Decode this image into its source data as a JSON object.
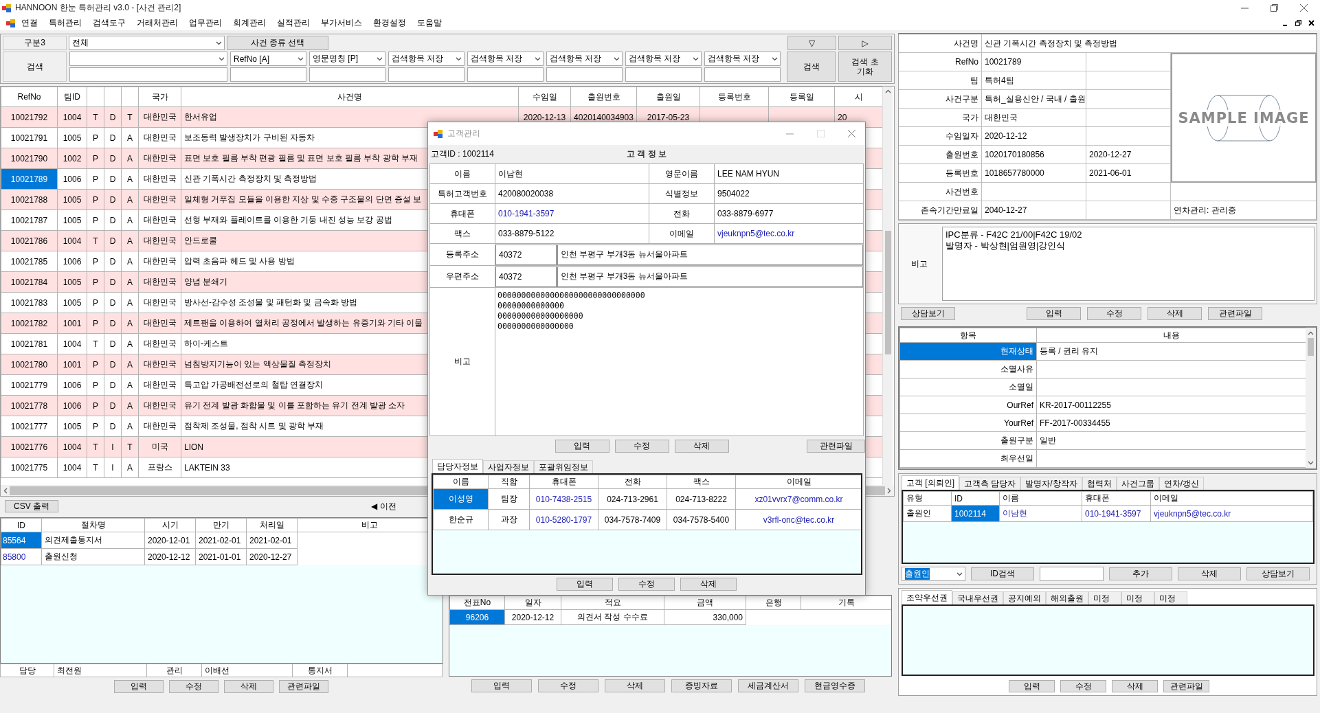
{
  "window": {
    "title": "HANNOON 한눈 특허관리 v3.0 - [사건 관리2]"
  },
  "menu": [
    "연결",
    "특허관리",
    "검색도구",
    "거래처관리",
    "업무관리",
    "회계관리",
    "실적관리",
    "부가서비스",
    "환경설정",
    "도움말"
  ],
  "filter": {
    "category_label": "구분3",
    "category_value": "전체",
    "case_type_button": "사건 종류 선택",
    "collapse_button": "▽",
    "next_button": "▷",
    "search_label": "검색",
    "search_fields": [
      {
        "kind": "wide"
      },
      {
        "kind": "normal",
        "selector": "RefNo [A]"
      },
      {
        "kind": "normal",
        "selector": "영문명칭 [P]"
      },
      {
        "kind": "normal",
        "selector": "검색항목 저장"
      },
      {
        "kind": "normal",
        "selector": "검색항목 저장"
      },
      {
        "kind": "normal",
        "selector": "검색항목 저장"
      },
      {
        "kind": "normal",
        "selector": "검색항목 저장"
      },
      {
        "kind": "normal",
        "selector": "검색항목 저장"
      }
    ],
    "search_button": "검색",
    "reset_button": "검색 초기화"
  },
  "case_table": {
    "headers": {
      "refno": "RefNo",
      "team_id": "팀ID",
      "country": "국가",
      "title": "사건명",
      "received": "수임일",
      "app_no": "출원번호",
      "app_date": "출원일",
      "reg_no": "등록번호",
      "reg_date": "등록일",
      "column_13": "시"
    },
    "rows": [
      {
        "refno": "10021792",
        "team_id": "1004",
        "column_3": "T",
        "column_4": "D",
        "column_5": "T",
        "country": "대한민국",
        "title": "한서유업",
        "received": "2020-12-13",
        "app_no": "4020140034903",
        "app_date": "2017-05-23",
        "column_13": "20",
        "selected": false
      },
      {
        "refno": "10021791",
        "team_id": "1005",
        "column_3": "P",
        "column_4": "D",
        "column_5": "A",
        "country": "대한민국",
        "title": "보조동력 발생장치가 구비된 자동차",
        "selected": false
      },
      {
        "refno": "10021790",
        "team_id": "1002",
        "column_3": "P",
        "column_4": "D",
        "column_5": "A",
        "country": "대한민국",
        "title": "표면 보호 필름 부착 편광 필름 및 표면 보호 필름 부착 광학 부재",
        "selected": false
      },
      {
        "refno": "10021789",
        "team_id": "1006",
        "column_3": "P",
        "column_4": "D",
        "column_5": "A",
        "country": "대한민국",
        "title": "신관 기폭시간 측정장치 및 측정방법",
        "selected": true
      },
      {
        "refno": "10021788",
        "team_id": "1005",
        "column_3": "P",
        "column_4": "D",
        "column_5": "A",
        "country": "대한민국",
        "title": "일체형 거푸집 모듈을 이용한 지상 및 수중 구조물의 단면 증설 보",
        "selected": false
      },
      {
        "refno": "10021787",
        "team_id": "1005",
        "column_3": "P",
        "column_4": "D",
        "column_5": "A",
        "country": "대한민국",
        "title": "선형 부재와 플레이트를 이용한 기둥 내진 성능 보강 공법",
        "selected": false
      },
      {
        "refno": "10021786",
        "team_id": "1004",
        "column_3": "T",
        "column_4": "D",
        "column_5": "A",
        "country": "대한민국",
        "title": "안드로쿨",
        "selected": false
      },
      {
        "refno": "10021785",
        "team_id": "1006",
        "column_3": "P",
        "column_4": "D",
        "column_5": "A",
        "country": "대한민국",
        "title": "압력 초음파 헤드 및 사용 방법",
        "selected": false
      },
      {
        "refno": "10021784",
        "team_id": "1005",
        "column_3": "P",
        "column_4": "D",
        "column_5": "A",
        "country": "대한민국",
        "title": "양념 분쇄기",
        "selected": false
      },
      {
        "refno": "10021783",
        "team_id": "1005",
        "column_3": "P",
        "column_4": "D",
        "column_5": "A",
        "country": "대한민국",
        "title": "방사선-감수성 조성물 및 패턴화 및 금속화 방법",
        "selected": false
      },
      {
        "refno": "10021782",
        "team_id": "1001",
        "column_3": "P",
        "column_4": "D",
        "column_5": "A",
        "country": "대한민국",
        "title": "제트팬을 이용하여 열처리 공정에서 발생하는 유증기와 기타 이물",
        "selected": false
      },
      {
        "refno": "10021781",
        "team_id": "1004",
        "column_3": "T",
        "column_4": "D",
        "column_5": "A",
        "country": "대한민국",
        "title": "하이-케스트",
        "selected": false
      },
      {
        "refno": "10021780",
        "team_id": "1001",
        "column_3": "P",
        "column_4": "D",
        "column_5": "A",
        "country": "대한민국",
        "title": "넘침방지기능이 있는 액상물질 측정장치",
        "selected": false
      },
      {
        "refno": "10021779",
        "team_id": "1006",
        "column_3": "P",
        "column_4": "D",
        "column_5": "A",
        "country": "대한민국",
        "title": "특고압 가공배전선로의 철탑 연결장치",
        "selected": false
      },
      {
        "refno": "10021778",
        "team_id": "1006",
        "column_3": "P",
        "column_4": "D",
        "column_5": "A",
        "country": "대한민국",
        "title": "유기 전계 발광 화합물 및 이를 포함하는 유기 전계 발광 소자",
        "selected": false
      },
      {
        "refno": "10021777",
        "team_id": "1005",
        "column_3": "P",
        "column_4": "D",
        "column_5": "A",
        "country": "대한민국",
        "title": "점착제 조성물, 점착 시트 및 광학 부재",
        "selected": false
      },
      {
        "refno": "10021776",
        "team_id": "1004",
        "column_3": "T",
        "column_4": "I",
        "column_5": "T",
        "country": "미국",
        "title": "LION",
        "selected": false
      },
      {
        "refno": "10021775",
        "team_id": "1004",
        "column_3": "T",
        "column_4": "I",
        "column_5": "A",
        "country": "프랑스",
        "title": "LAKTEIN 33",
        "selected": false
      }
    ]
  },
  "csv_button": "CSV 출력",
  "previous_button": "◀ 이전",
  "procedures": {
    "headers": [
      "ID",
      "절차명",
      "시기",
      "만기",
      "처리일",
      "비고"
    ],
    "rows": [
      {
        "cells": [
          "85564",
          "의견제출통지서",
          "2020-12-01",
          "2021-02-01",
          "2021-02-01"
        ],
        "selected": true
      },
      {
        "cells": [
          "85800",
          "출원신청",
          "2020-12-12",
          "2021-01-01",
          "2020-12-27"
        ],
        "selected": false
      }
    ],
    "footer": [
      {
        "label": "담당",
        "value": "최전원"
      },
      {
        "label": "관리",
        "value": "이배선"
      },
      {
        "label": "통지서"
      }
    ],
    "buttons": [
      "입력",
      "수정",
      "삭제",
      "관련파일"
    ]
  },
  "accounting": {
    "headers": [
      "전표No",
      "일자",
      "적요",
      "금액",
      "은행",
      "기록"
    ],
    "rows": [
      {
        "cells": [
          "96206",
          "2020-12-12",
          "의견서 작성 수수료",
          "330,000"
        ],
        "selected": true
      }
    ],
    "buttons": [
      "입력",
      "수정",
      "삭제",
      "증빙자료",
      "세금계산서",
      "현금영수증"
    ]
  },
  "case_info": {
    "rows": [
      {
        "kind": "wide",
        "label": "사건명",
        "value": "신관 기폭시간 측정장치 및 측정방법"
      },
      {
        "kind": "side",
        "label": "RefNo",
        "value": "10021789"
      },
      {
        "kind": "side",
        "label": "팀",
        "value": "특허4팀"
      },
      {
        "kind": "side",
        "label": "사건구분",
        "value": "특허_실용신안 / 국내 / 출원"
      },
      {
        "kind": "side",
        "label": "국가",
        "value": "대한민국"
      },
      {
        "kind": "side",
        "label": "수임일자",
        "value": "2020-12-12"
      },
      {
        "kind": "side",
        "label": "출원번호",
        "value": "1020170180856",
        "date": "2020-12-27"
      },
      {
        "kind": "side",
        "label": "등록번호",
        "value": "1018657780000",
        "date": "2021-06-01"
      },
      {
        "kind": "full",
        "label": "사건번호"
      },
      {
        "kind": "full",
        "label": "존속기간만료일",
        "value": "2040-12-27",
        "extra": "연차관리: 관리중"
      }
    ],
    "image_caption": "SAMPLE IMAGE",
    "note_label": "비고",
    "note_lines": [
      "IPC분류 - F42C 21/00|F42C 19/02",
      "발명자 - 박상현|엄원영|강인식"
    ],
    "consult_button": "상담보기",
    "buttons": [
      "입력",
      "수정",
      "삭제",
      "관련파일"
    ]
  },
  "items": {
    "headers": [
      "항목",
      "내용"
    ],
    "rows": [
      {
        "label": "현재상태",
        "value": "등록 / 권리 유지",
        "selected": true
      },
      {
        "label": "소멸사유",
        "selected": false
      },
      {
        "label": "소멸일",
        "selected": false
      },
      {
        "label": "OurRef",
        "value": "KR-2017-00112255",
        "selected": false
      },
      {
        "label": "YourRef",
        "value": "FF-2017-00334455",
        "selected": false
      },
      {
        "label": "출원구분",
        "value": "일반",
        "selected": false
      },
      {
        "label": "최우선일",
        "selected": false
      }
    ]
  },
  "client_tabs": {
    "tabs": [
      {
        "label": "고객 [의뢰인]",
        "selected": true
      },
      {
        "label": "고객측 담당자",
        "selected": false
      },
      {
        "label": "발명자/창작자",
        "selected": false
      },
      {
        "label": "협력처",
        "selected": false
      },
      {
        "label": "사건그룹",
        "selected": false
      },
      {
        "label": "연차/갱신",
        "selected": false
      }
    ],
    "headers": [
      "유형",
      "ID",
      "이름",
      "휴대폰",
      "이메일"
    ],
    "rows": [
      {
        "type": "출원인",
        "id": "1002114",
        "name": "이남현",
        "mobile": "010-1941-3597",
        "email": "vjeuknpn5@tec.co.kr",
        "selected": true
      }
    ],
    "role_select": "출원인",
    "id_search_button": "ID검색",
    "buttons": [
      "추가",
      "삭제",
      "상담보기"
    ]
  },
  "priority_tabs": {
    "tabs": [
      {
        "label": "조약우선권",
        "selected": true
      },
      {
        "label": "국내우선권",
        "selected": false
      },
      {
        "label": "공지예외",
        "selected": false
      },
      {
        "label": "해외출원",
        "selected": false
      },
      {
        "label": "미정",
        "selected": false
      },
      {
        "label": "미정",
        "selected": false
      },
      {
        "label": "미정",
        "selected": false
      }
    ],
    "buttons": [
      "입력",
      "수정",
      "삭제",
      "관련파일"
    ]
  },
  "dialog": {
    "title": "고객관리",
    "customer_id": "고객ID : 1002114",
    "heading": "고 객 정 보",
    "fields": [
      {
        "label": "이름",
        "value": "이남현",
        "kind": "text"
      },
      {
        "label": "영문이름",
        "value": "LEE NAM HYUN",
        "kind": "text"
      },
      {
        "label": "특허고객번호",
        "value": "420080020038",
        "kind": "text"
      },
      {
        "label": "식별정보",
        "value": "9504022",
        "kind": "text"
      },
      {
        "label": "휴대폰",
        "value": "010-1941-3597",
        "kind": "link"
      },
      {
        "label": "전화",
        "value": "033-8879-6977",
        "kind": "text"
      },
      {
        "label": "팩스",
        "value": "033-8879-5122",
        "kind": "text"
      },
      {
        "label": "이메일",
        "value": "vjeuknpn5@tec.co.kr",
        "kind": "link"
      }
    ],
    "addresses": [
      {
        "label": "등록주소",
        "zip": "40372",
        "address": "인천 부평구 부개3동 뉴서울아파트"
      },
      {
        "label": "우편주소",
        "zip": "40372",
        "address": "인천 부평구 부개3동 뉴서울아파트"
      }
    ],
    "note_label": "비고",
    "note_lines": [
      "0000000000000000000000000000000",
      "00000000000000",
      "000000000000000000",
      "0000000000000000"
    ],
    "buttons": [
      "입력",
      "수정",
      "삭제"
    ],
    "files_button": "관련파일",
    "tabs": [
      {
        "label": "담당자정보",
        "selected": true
      },
      {
        "label": "사업자정보",
        "selected": false
      },
      {
        "label": "포괄위임정보",
        "selected": false
      }
    ],
    "contacts": {
      "headers": [
        {
          "label": "이름",
          "kind": "text"
        },
        {
          "label": "직함",
          "kind": "text"
        },
        {
          "label": "휴대폰",
          "kind": "link"
        },
        {
          "label": "전화",
          "kind": "text"
        },
        {
          "label": "팩스",
          "kind": "text"
        },
        {
          "label": "이메일",
          "kind": "link"
        }
      ],
      "rows": [
        {
          "cells": [
            "이성영",
            "팀장",
            "010-7438-2515",
            "024-713-2961",
            "024-713-8222",
            "xz01vvrx7@comm.co.kr"
          ],
          "selected": true
        },
        {
          "cells": [
            "한순규",
            "과장",
            "010-5280-1797",
            "034-7578-7409",
            "034-7578-5400",
            "v3rfl-onc@tec.co.kr"
          ],
          "selected": false
        }
      ]
    },
    "contact_buttons": [
      "입력",
      "수정",
      "삭제"
    ]
  }
}
